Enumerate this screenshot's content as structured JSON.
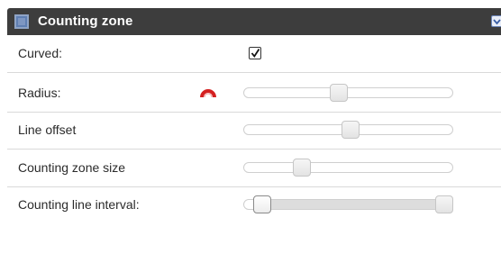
{
  "panel": {
    "title": "Counting zone",
    "header_icon": "square-panel-icon",
    "collapse_icon": "chevron-down-icon"
  },
  "rows": {
    "curved": {
      "label": "Curved:",
      "checked": true
    },
    "radius": {
      "label": "Radius:",
      "icon": "arc-radius-icon",
      "value_fraction": 0.45
    },
    "line_offset": {
      "label": "Line offset",
      "value_fraction": 0.51
    },
    "zone_size": {
      "label": "Counting zone size",
      "value_fraction": 0.26
    },
    "line_interval": {
      "label": "Counting line interval:",
      "range_fraction": [
        0.05,
        1.0
      ]
    }
  },
  "colors": {
    "header_bg": "#3d3d3d",
    "radius_icon": "#d42020",
    "track_border": "#cfcfcf",
    "range_fill": "#dddddd"
  }
}
